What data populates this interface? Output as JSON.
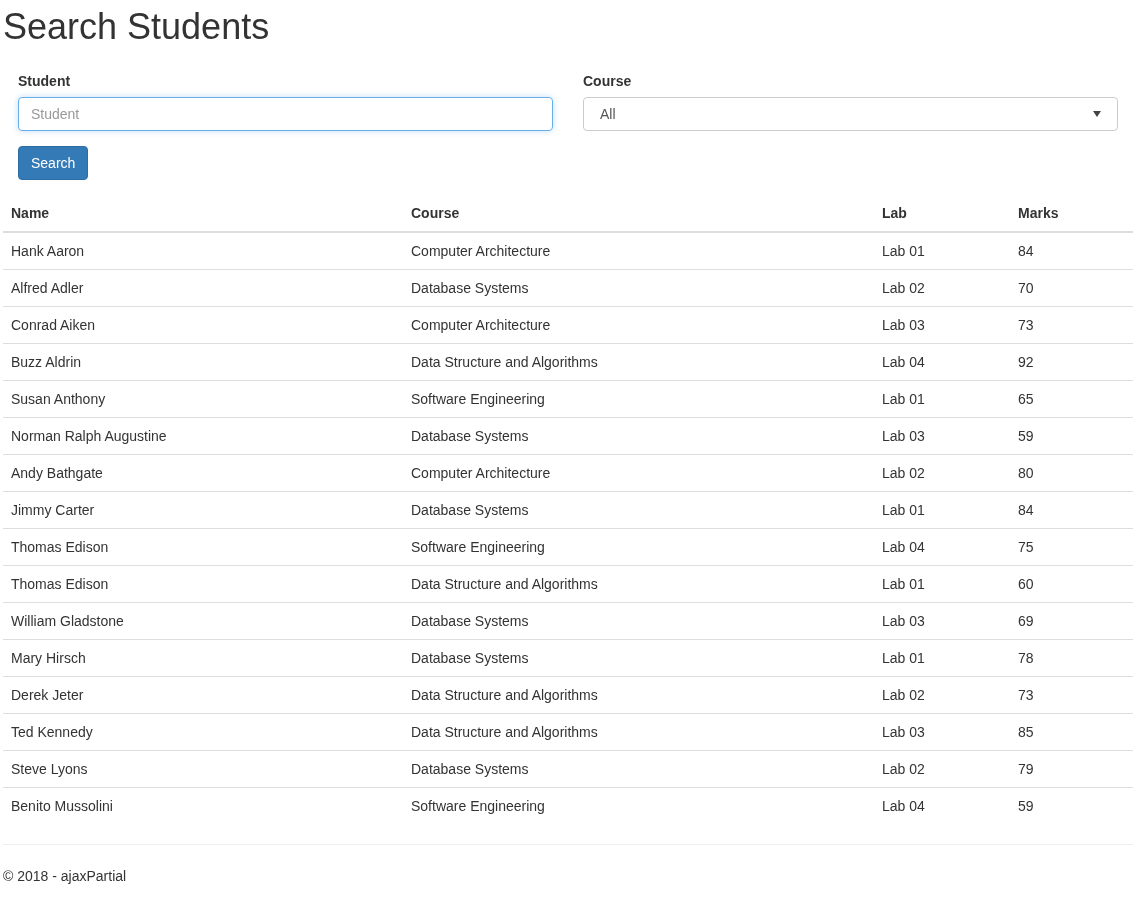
{
  "title": "Search Students",
  "form": {
    "student": {
      "label": "Student",
      "placeholder": "Student",
      "focused": true
    },
    "course": {
      "label": "Course",
      "value": "All"
    },
    "search_button": "Search"
  },
  "table": {
    "columns": [
      "Name",
      "Course",
      "Lab",
      "Marks"
    ],
    "rows": [
      [
        "Hank Aaron",
        "Computer Architecture",
        "Lab 01",
        "84"
      ],
      [
        "Alfred Adler",
        "Database Systems",
        "Lab 02",
        "70"
      ],
      [
        "Conrad Aiken",
        "Computer Architecture",
        "Lab 03",
        "73"
      ],
      [
        "Buzz Aldrin",
        "Data Structure and Algorithms",
        "Lab 04",
        "92"
      ],
      [
        "Susan Anthony",
        "Software Engineering",
        "Lab 01",
        "65"
      ],
      [
        "Norman Ralph Augustine",
        "Database Systems",
        "Lab 03",
        "59"
      ],
      [
        "Andy Bathgate",
        "Computer Architecture",
        "Lab 02",
        "80"
      ],
      [
        "Jimmy Carter",
        "Database Systems",
        "Lab 01",
        "84"
      ],
      [
        "Thomas Edison",
        "Software Engineering",
        "Lab 04",
        "75"
      ],
      [
        "Thomas Edison",
        "Data Structure and Algorithms",
        "Lab 01",
        "60"
      ],
      [
        "William Gladstone",
        "Database Systems",
        "Lab 03",
        "69"
      ],
      [
        "Mary Hirsch",
        "Database Systems",
        "Lab 01",
        "78"
      ],
      [
        "Derek Jeter",
        "Data Structure and Algorithms",
        "Lab 02",
        "73"
      ],
      [
        "Ted Kennedy",
        "Data Structure and Algorithms",
        "Lab 03",
        "85"
      ],
      [
        "Steve Lyons",
        "Database Systems",
        "Lab 02",
        "79"
      ],
      [
        "Benito Mussolini",
        "Software Engineering",
        "Lab 04",
        "59"
      ]
    ]
  },
  "footer": "© 2018 - ajaxPartial"
}
